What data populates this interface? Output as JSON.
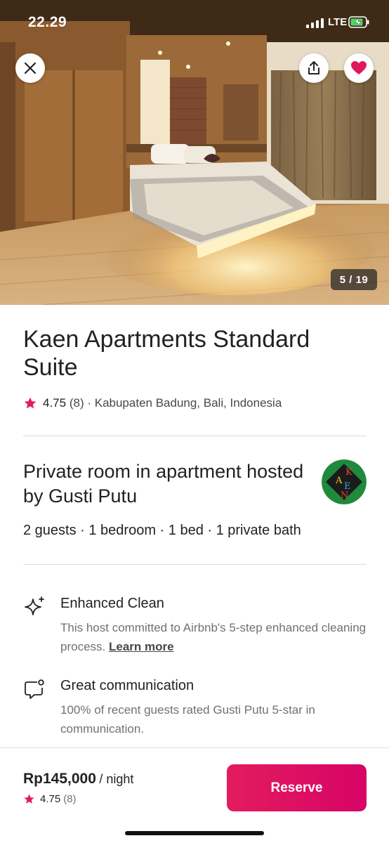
{
  "status_bar": {
    "time": "22.29",
    "network": "LTE"
  },
  "gallery": {
    "counter": "5 / 19"
  },
  "listing": {
    "title": "Kaen Apartments Standard Suite",
    "rating": "4.75",
    "reviews": "(8)",
    "location": "· Kabupaten Badung, Bali, Indonesia"
  },
  "host": {
    "heading": "Private room in apartment hosted by Gusti Putu",
    "avatar_letters": [
      "K",
      "A",
      "E",
      "N"
    ],
    "summary": "2 guests · 1 bedroom · 1 bed · 1 private bath"
  },
  "features": [
    {
      "icon": "sparkle-icon",
      "title": "Enhanced Clean",
      "description": "This host committed to Airbnb's 5-step enhanced cleaning process.",
      "link": "Learn more"
    },
    {
      "icon": "chat-bubble-icon",
      "title": "Great communication",
      "description": "100% of recent guests rated Gusti Putu 5-star in communication."
    }
  ],
  "booking": {
    "price": "Rp145,000",
    "per": "/ night",
    "rating": "4.75",
    "reviews": "(8)",
    "reserve_label": "Reserve"
  },
  "colors": {
    "brand": "#e31c5f",
    "text": "#222222",
    "muted": "#717171",
    "divider": "#dddddd"
  }
}
